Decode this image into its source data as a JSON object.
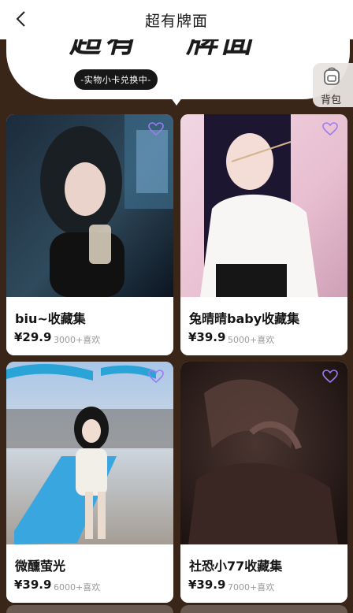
{
  "header": {
    "title": "超有牌面"
  },
  "banner": {
    "word_left": "超有",
    "word_right": "牌面",
    "pill_text": "-实物小卡兑换中-"
  },
  "bag": {
    "label": "背包",
    "icon": "backpack-icon"
  },
  "cards": [
    {
      "name": "biu~收藏集",
      "price": "¥29.9",
      "likes": "3000+喜欢"
    },
    {
      "name": "兔晴晴baby收藏集",
      "price": "¥39.9",
      "likes": "5000+喜欢"
    },
    {
      "name": "微醺萤光",
      "price": "¥39.9",
      "likes": "6000+喜欢"
    },
    {
      "name": "社恐小77收藏集",
      "price": "¥39.9",
      "likes": "7000+喜欢"
    }
  ],
  "colors": {
    "page_bg": "#3a2519",
    "heart": "#9b7cf0",
    "text": "#141414",
    "muted": "#9a9a9a"
  }
}
